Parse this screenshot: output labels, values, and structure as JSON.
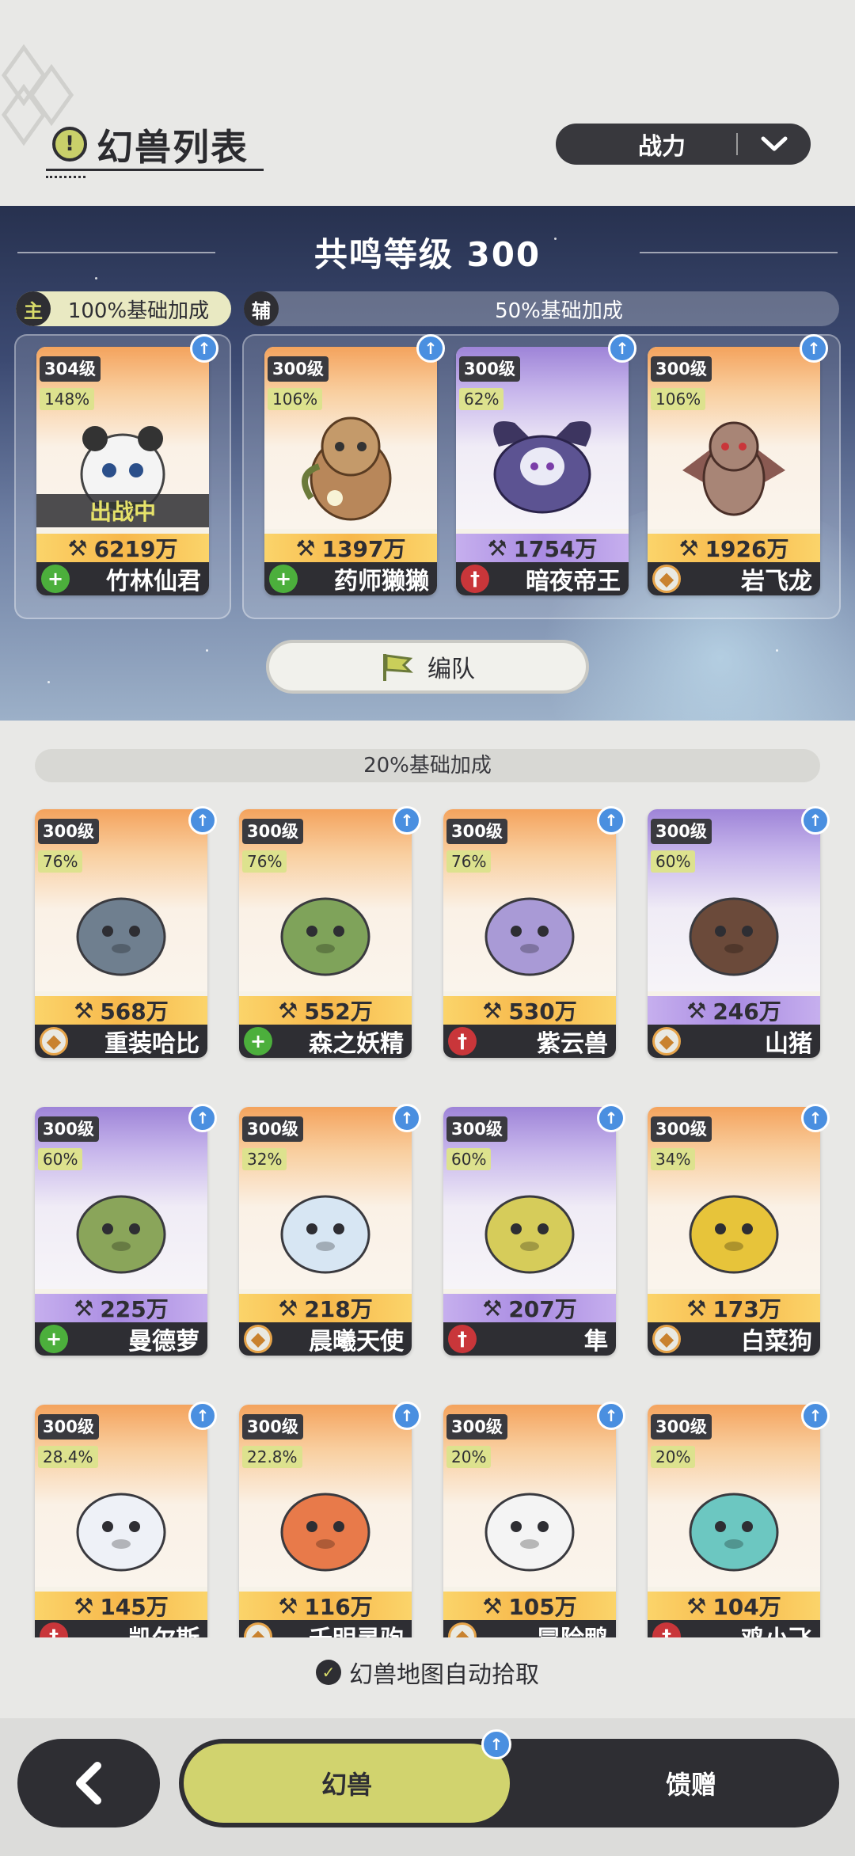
{
  "header": {
    "title": "幻兽列表",
    "title_icon": "!",
    "sort_label": "战力"
  },
  "resonance": {
    "title": "共鸣等级 300",
    "main_tag": "主",
    "main_bonus": "100%基础加成",
    "sub_tag": "辅",
    "sub_bonus": "50%基础加成",
    "team_button": "编队"
  },
  "team": [
    {
      "level": "304级",
      "pct": "148%",
      "power": "6219万",
      "name": "竹林仙君",
      "role": "heal",
      "status": "出战中"
    },
    {
      "level": "300级",
      "pct": "106%",
      "power": "1397万",
      "name": "药师獭獭",
      "role": "heal"
    },
    {
      "level": "300级",
      "pct": "62%",
      "power": "1754万",
      "name": "暗夜帝王",
      "role": "atk"
    },
    {
      "level": "300级",
      "pct": "106%",
      "power": "1926万",
      "name": "岩飞龙",
      "role": "def"
    }
  ],
  "list_bonus": "20%基础加成",
  "beasts": [
    {
      "level": "300级",
      "pct": "76%",
      "power": "568万",
      "name": "重装哈比",
      "role": "def",
      "theme": "orange"
    },
    {
      "level": "300级",
      "pct": "76%",
      "power": "552万",
      "name": "森之妖精",
      "role": "heal",
      "theme": "orange"
    },
    {
      "level": "300级",
      "pct": "76%",
      "power": "530万",
      "name": "紫云兽",
      "role": "atk",
      "theme": "orange"
    },
    {
      "level": "300级",
      "pct": "60%",
      "power": "246万",
      "name": "山猪",
      "role": "def",
      "theme": "purple"
    },
    {
      "level": "300级",
      "pct": "60%",
      "power": "225万",
      "name": "曼德萝",
      "role": "heal",
      "theme": "purple"
    },
    {
      "level": "300级",
      "pct": "32%",
      "power": "218万",
      "name": "晨曦天使",
      "role": "def",
      "theme": "orange"
    },
    {
      "level": "300级",
      "pct": "60%",
      "power": "207万",
      "name": "隼",
      "role": "atk",
      "theme": "purple"
    },
    {
      "level": "300级",
      "pct": "34%",
      "power": "173万",
      "name": "白菜狗",
      "role": "def",
      "theme": "orange"
    },
    {
      "level": "300级",
      "pct": "28.4%",
      "power": "145万",
      "name": "凯尔斯",
      "role": "atk",
      "theme": "orange"
    },
    {
      "level": "300级",
      "pct": "22.8%",
      "power": "116万",
      "name": "千明灵驹",
      "role": "def",
      "theme": "orange"
    },
    {
      "level": "300级",
      "pct": "20%",
      "power": "105万",
      "name": "冒险鸭",
      "role": "def",
      "theme": "orange"
    },
    {
      "level": "300级",
      "pct": "20%",
      "power": "104万",
      "name": "鸡小飞",
      "role": "atk",
      "theme": "orange"
    }
  ],
  "auto_pick_label": "幻兽地图自动拾取",
  "nav": {
    "tab_beasts": "幻兽",
    "tab_gift": "馈赠"
  },
  "colors": {
    "accent": "#d1d36e",
    "dark": "#2e2e33",
    "orange_card": "#f4a35d",
    "purple_card": "#9e84d8"
  }
}
